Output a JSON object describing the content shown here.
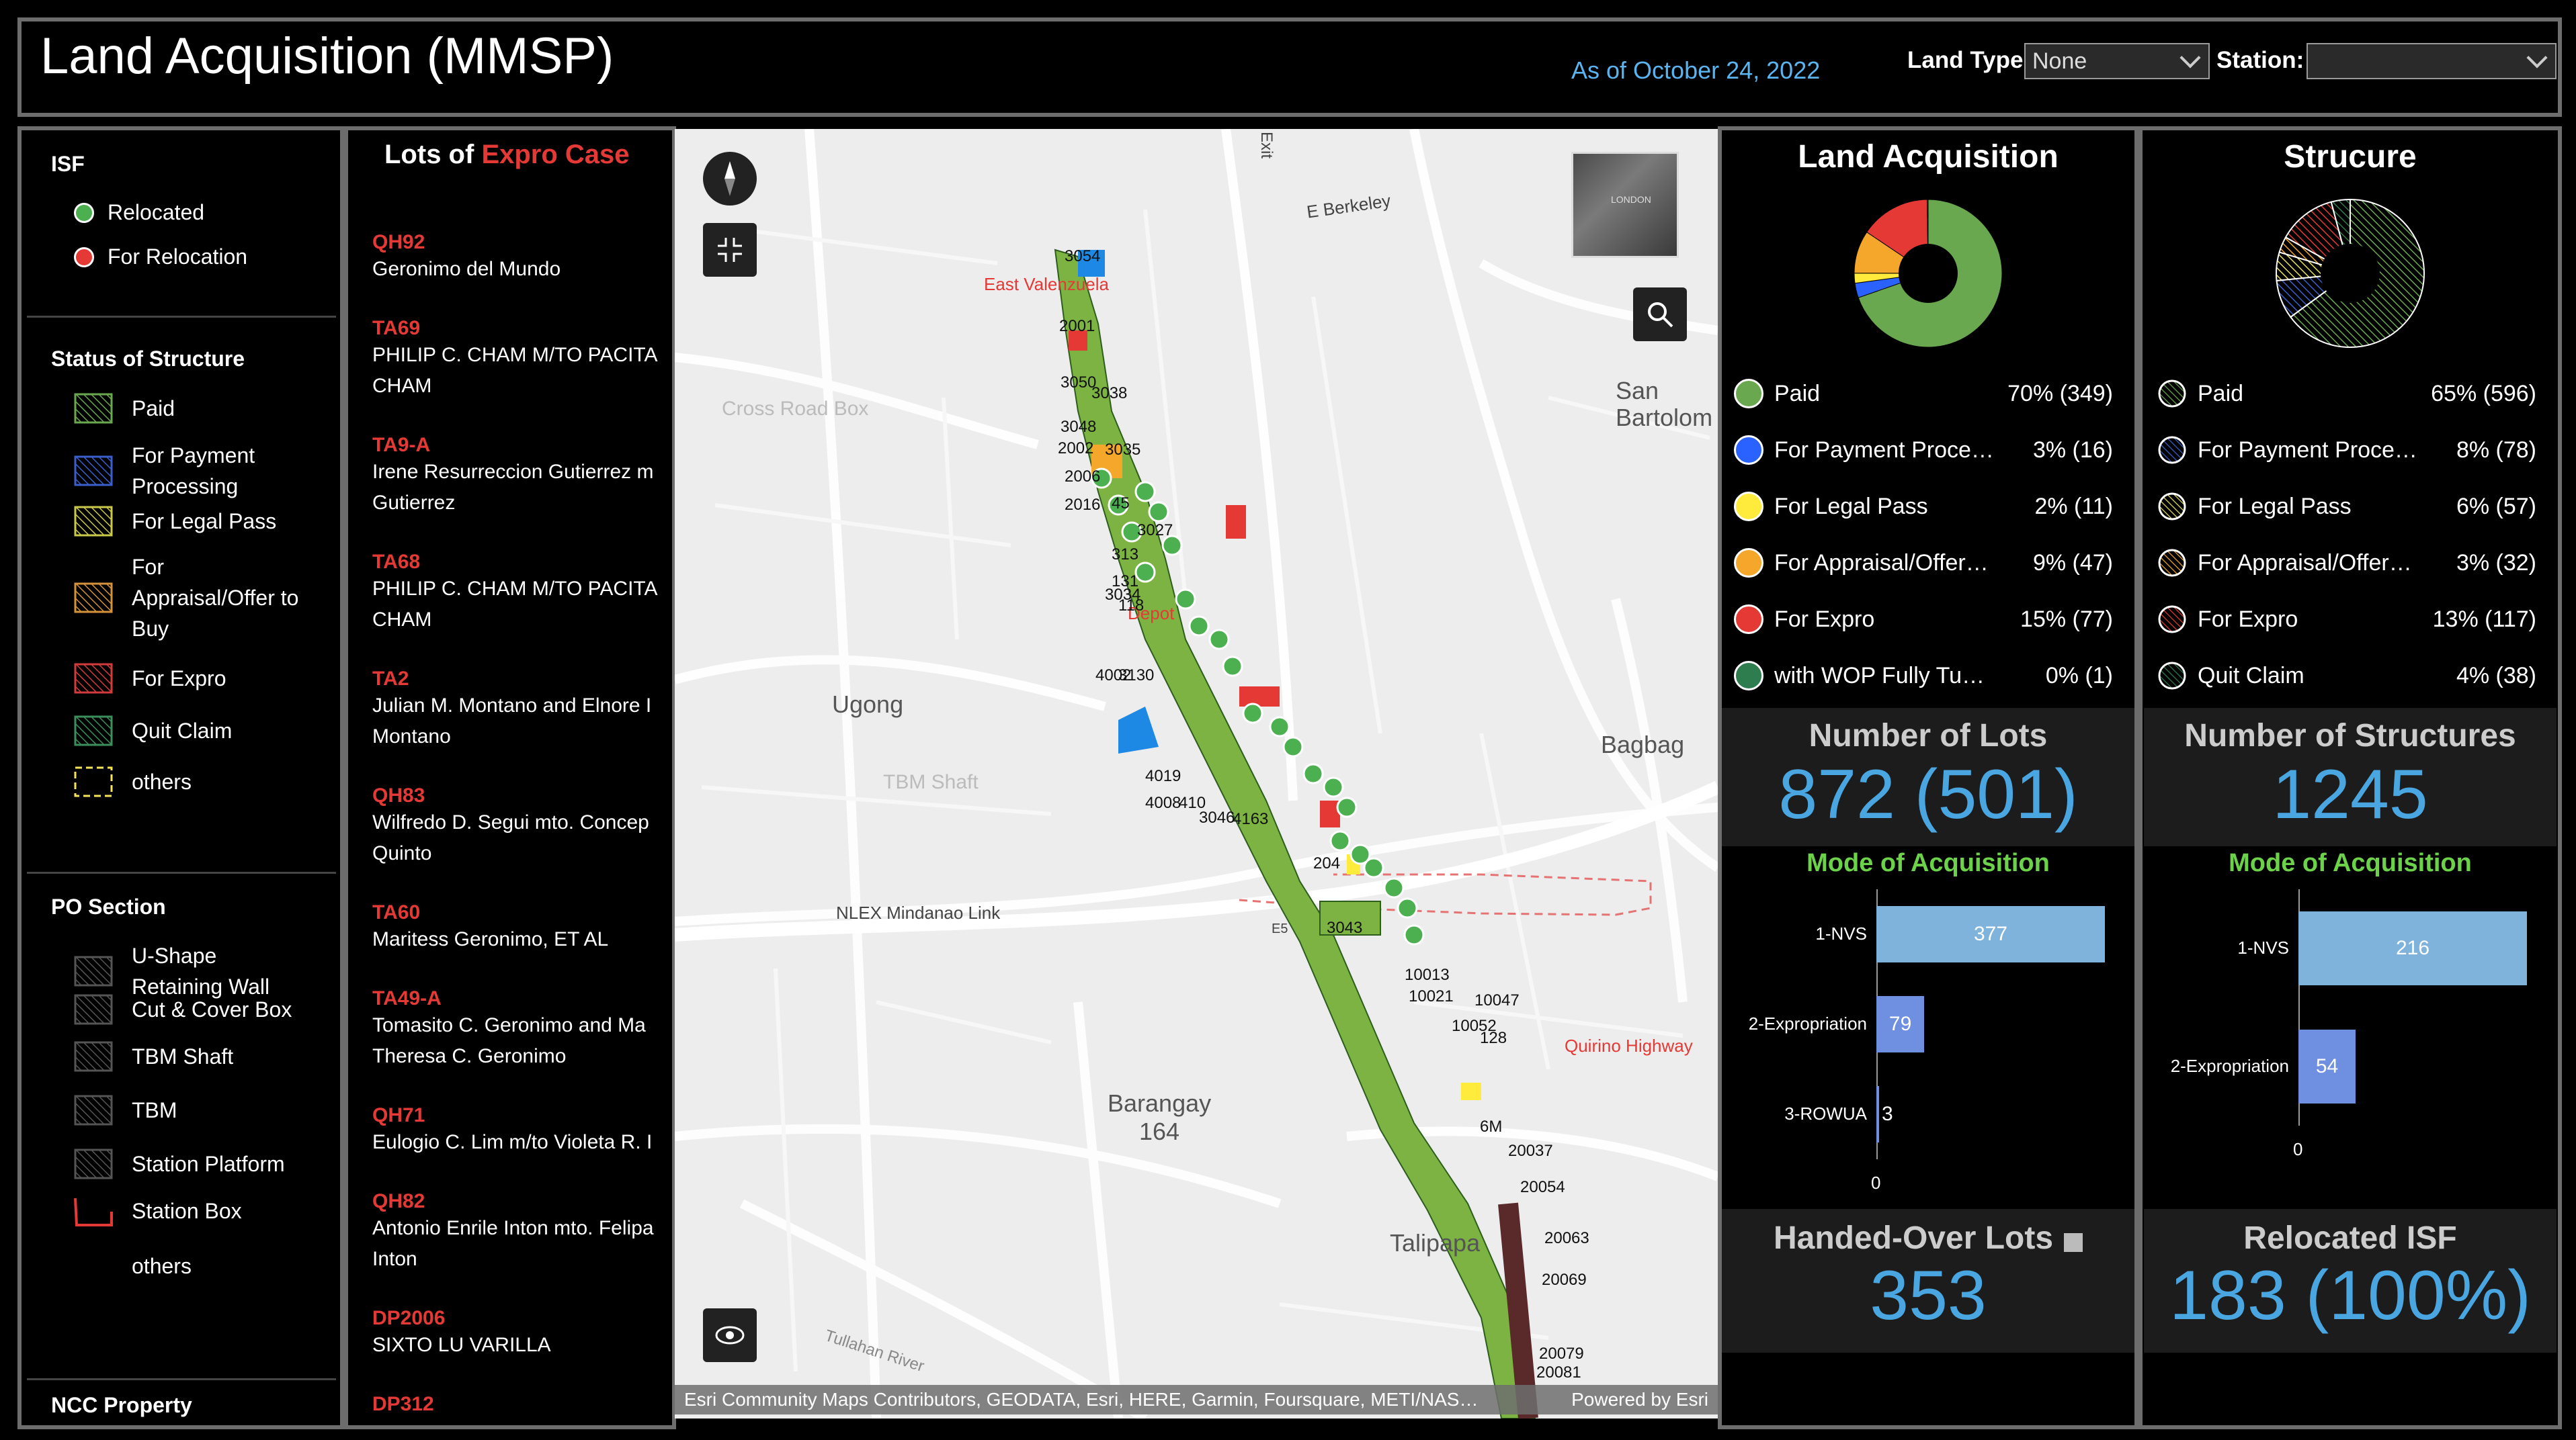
{
  "header": {
    "title": "Land Acquisition (MMSP)",
    "as_of": "As of October 24, 2022",
    "land_type_label": "Land Type",
    "land_type_value": "None",
    "station_label": "Station:",
    "station_value": ""
  },
  "legend": {
    "isf_title": "ISF",
    "isf_items": [
      "Relocated",
      "For Relocation"
    ],
    "status_title": "Status of Structure",
    "status_items": [
      "Paid",
      "For Payment Processing",
      "For Legal Pass",
      "For Appraisal/Offer to Buy",
      "For Expro",
      "Quit Claim",
      "others"
    ],
    "po_title": "PO Section",
    "po_items": [
      "U-Shape Retaining Wall",
      "Cut & Cover Box",
      "TBM Shaft",
      "TBM",
      "Station Platform",
      "Station Box",
      "others"
    ],
    "ncc_title": "NCC Property"
  },
  "lots": {
    "title_prefix": "Lots of",
    "title_highlight": "Expro Case",
    "items": [
      {
        "id": "QH92",
        "name": "Geronimo del Mundo"
      },
      {
        "id": "TA69",
        "name": "PHILIP C. CHAM M/TO PACITA\nCHAM"
      },
      {
        "id": "TA9-A",
        "name": "Irene Resurreccion Gutierrez m\nGutierrez"
      },
      {
        "id": "TA68",
        "name": "PHILIP C. CHAM M/TO PACITA\nCHAM"
      },
      {
        "id": "TA2",
        "name": "Julian M. Montano and Elnore I\nMontano"
      },
      {
        "id": "QH83",
        "name": "Wilfredo D. Segui mto. Concep\nQuinto"
      },
      {
        "id": "TA60",
        "name": "Maritess Geronimo, ET AL"
      },
      {
        "id": "TA49-A",
        "name": "Tomasito C. Geronimo and Ma\nTheresa C. Geronimo"
      },
      {
        "id": "QH71",
        "name": "Eulogio C. Lim m/to Violeta R. I"
      },
      {
        "id": "QH82",
        "name": "Antonio Enrile Inton mto. Felipa\nInton"
      },
      {
        "id": "DP2006",
        "name": "SIXTO LU VARILLA"
      },
      {
        "id": "DP312",
        "name": ""
      }
    ]
  },
  "map": {
    "labels": {
      "berkeley": "E Berkeley",
      "cross_road": "Cross Road Box",
      "east_valenzuela": "East Valenzuela",
      "depot": "Depot",
      "ugong": "Ugong",
      "bagbag": "Bagbag",
      "san_bartolome": "San\nBartolom",
      "tbm_shaft": "TBM Shaft",
      "nlex": "NLEX Mindanao Link",
      "e5": "E5",
      "quirino": "Quirino Highway",
      "barangay164": "Barangay\n164",
      "talipapa": "Talipapa",
      "tullahan": "Tullahan River",
      "exit": "Exit",
      "mini_map_text": "LONDON"
    },
    "lot_numbers": [
      "3054",
      "2001",
      "3050",
      "3038",
      "3048",
      "2002",
      "3035",
      "2006",
      "2016",
      "45",
      "3027",
      "313",
      "131",
      "3034",
      "118",
      "4002",
      "3130",
      "4019",
      "4008",
      "410",
      "3046",
      "4163",
      "204",
      "3043",
      "10013",
      "10021",
      "10047",
      "10052",
      "20037",
      "20054",
      "20063",
      "20069",
      "20079",
      "20081",
      "128",
      "6M"
    ],
    "attribution": "Esri Community Maps Contributors, GEODATA, Esri, HERE, Garmin, Foursquare, METI/NAS…",
    "powered": "Powered by Esri"
  },
  "land_acq": {
    "title": "Land Acquisition",
    "rows": [
      {
        "label": "Paid",
        "value": "70% (349)",
        "color": "#6aa84f"
      },
      {
        "label": "For Payment Proce…",
        "value": "3% (16)",
        "color": "#2962ff"
      },
      {
        "label": "For Legal Pass",
        "value": "2% (11)",
        "color": "#ffeb3b"
      },
      {
        "label": "For Appraisal/Offer…",
        "value": "9% (47)",
        "color": "#f4a72a"
      },
      {
        "label": "For Expro",
        "value": "15% (77)",
        "color": "#e53935"
      },
      {
        "label": "with WOP Fully Tu…",
        "value": "0% (1)",
        "color": "#2e7d4f"
      }
    ],
    "pie": [
      349,
      16,
      11,
      47,
      77,
      1
    ],
    "lots_title": "Number of Lots",
    "lots_value": "872 (501)",
    "moa_title": "Mode of Acquisition",
    "moa": [
      {
        "label": "1-NVS",
        "value": 377
      },
      {
        "label": "2-Expropriation",
        "value": 79
      },
      {
        "label": "3-ROWUA",
        "value": 3
      }
    ],
    "moa_zero": "0",
    "handed_title": "Handed-Over Lots",
    "handed_value": "353"
  },
  "structure": {
    "title": "Strucure",
    "rows": [
      {
        "label": "Paid",
        "value": "65% (596)",
        "color": "#6aa84f"
      },
      {
        "label": "For Payment Proce…",
        "value": "8% (78)",
        "color": "#3a5fcd"
      },
      {
        "label": "For Legal Pass",
        "value": "6% (57)",
        "color": "#e8e25a"
      },
      {
        "label": "For Appraisal/Offer…",
        "value": "3% (32)",
        "color": "#f4a72a"
      },
      {
        "label": "For Expro",
        "value": "13% (117)",
        "color": "#e53935"
      },
      {
        "label": "Quit Claim",
        "value": "4% (38)",
        "color": "#2e7d4f"
      }
    ],
    "pie": [
      596,
      78,
      57,
      32,
      117,
      38
    ],
    "count_title": "Number of Structures",
    "count_value": "1245",
    "moa_title": "Mode of Acquisition",
    "moa": [
      {
        "label": "1-NVS",
        "value": 216
      },
      {
        "label": "2-Expropriation",
        "value": 54
      }
    ],
    "moa_zero": "0",
    "isf_title": "Relocated ISF",
    "isf_value": "183 (100%)"
  }
}
